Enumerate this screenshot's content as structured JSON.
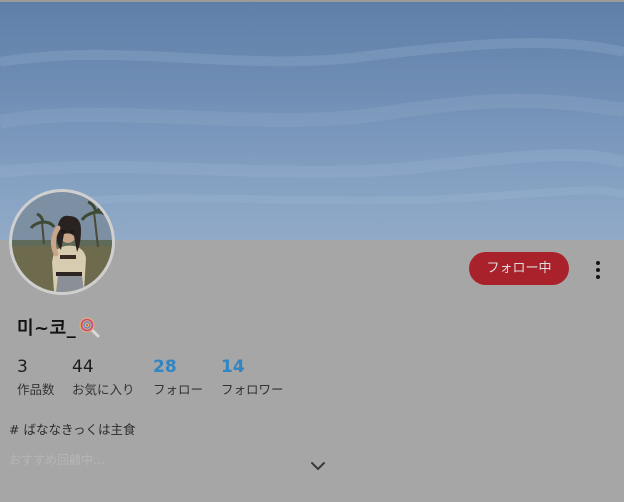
{
  "profile": {
    "name": "미~코_",
    "follow_button": "フォロー中",
    "bio": "# ばななきっくは主食",
    "bio_faded": "おすすめ回顧中…"
  },
  "stats": [
    {
      "value": "3",
      "label": "作品数"
    },
    {
      "value": "44",
      "label": "お気に入り"
    },
    {
      "value": "28",
      "label": "フォロー"
    },
    {
      "value": "14",
      "label": "フォロワー"
    }
  ],
  "icons": {
    "name_emoji": "lollipop-icon",
    "more": "more-vertical-icon",
    "expand": "chevron-down-icon"
  },
  "colors": {
    "follow_button_bg": "#a8212b",
    "accent_number": "#2f86c3",
    "overlay_bg": "#a6a6a6"
  }
}
